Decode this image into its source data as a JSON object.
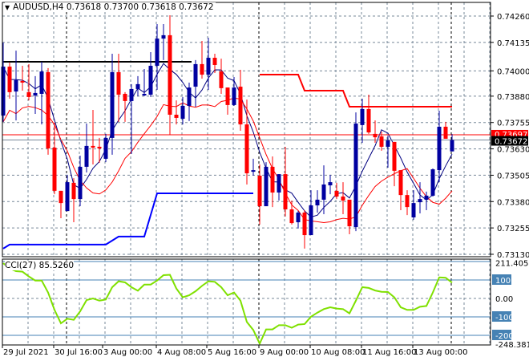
{
  "header": {
    "symbol": "AUDUSD,H4",
    "open": "0.73618",
    "high": "0.73700",
    "low": "0.73618",
    "close": "0.73672",
    "menu_icon": "triangle-down-icon"
  },
  "price_axis": {
    "ticks": [
      "0.74260",
      "0.74135",
      "0.74000",
      "0.73880",
      "0.73755",
      "0.73630",
      "0.73505",
      "0.73380",
      "0.73255",
      "0.73130"
    ],
    "ask_label": "0.73697",
    "bid_label": "0.73672"
  },
  "time_axis": {
    "labels": [
      "29 Jul 2021",
      "30 Jul 16:00",
      "3 Aug 00:00",
      "4 Aug 08:00",
      "5 Aug 16:00",
      "9 Aug 00:00",
      "10 Aug 08:00",
      "11 Aug 16:00",
      "13 Aug 00:00"
    ]
  },
  "indicator": {
    "label": "CCI(27) 85.5260",
    "axis_labels": [
      "211.4057",
      "100",
      "0.00",
      "-100",
      "-200",
      "-248.381"
    ],
    "levels": [
      200,
      100,
      -100,
      -200
    ],
    "max": 211.4057,
    "min": -248.381
  },
  "colors": {
    "bull": "#0000a0",
    "bear": "#ff0000",
    "ma": "#000080",
    "lower": "#ff0000",
    "cci": "#7fe000",
    "level": "#4682b4",
    "grid": "#778899",
    "resistance": "#ff0000",
    "support": "#0000ff"
  },
  "chart_data": {
    "type": "candlestick",
    "title": "AUDUSD,H4",
    "ylim": [
      0.7313,
      0.7426
    ],
    "ohlc": [
      [
        0.73788,
        0.74134,
        0.73758,
        0.7402
      ],
      [
        0.7402,
        0.74039,
        0.73868,
        0.73899
      ],
      [
        0.73902,
        0.74096,
        0.73765,
        0.73956
      ],
      [
        0.73952,
        0.74024,
        0.73906,
        0.73948
      ],
      [
        0.73899,
        0.74032,
        0.7386,
        0.73876
      ],
      [
        0.73883,
        0.73975,
        0.73796,
        0.73895
      ],
      [
        0.73891,
        0.74043,
        0.73746,
        0.73997
      ],
      [
        0.73994,
        0.74013,
        0.73602,
        0.73632
      ],
      [
        0.73636,
        0.73754,
        0.73415,
        0.73431
      ],
      [
        0.73431,
        0.73431,
        0.73301,
        0.73373
      ],
      [
        0.73335,
        0.73507,
        0.73335,
        0.73472
      ],
      [
        0.73469,
        0.73491,
        0.73282,
        0.73392
      ],
      [
        0.73392,
        0.73598,
        0.73358,
        0.73545
      ],
      [
        0.73545,
        0.7375,
        0.73518,
        0.73644
      ],
      [
        0.73644,
        0.73815,
        0.73556,
        0.73636
      ],
      [
        0.7364,
        0.73682,
        0.73564,
        0.73632
      ],
      [
        0.73583,
        0.73701,
        0.73567,
        0.73682
      ],
      [
        0.73682,
        0.74081,
        0.73602,
        0.73994
      ],
      [
        0.73994,
        0.74081,
        0.73758,
        0.73887
      ],
      [
        0.73891,
        0.73899,
        0.73758,
        0.73857
      ],
      [
        0.73857,
        0.73937,
        0.73606,
        0.73914
      ],
      [
        0.73914,
        0.73975,
        0.7388,
        0.73937
      ],
      [
        0.73887,
        0.74009,
        0.7388,
        0.73891
      ],
      [
        0.73887,
        0.74089,
        0.73876,
        0.74024
      ],
      [
        0.74024,
        0.74222,
        0.7391,
        0.74153
      ],
      [
        0.74153,
        0.74222,
        0.74051,
        0.74169
      ],
      [
        0.74169,
        0.74264,
        0.73697,
        0.73792
      ],
      [
        0.73792,
        0.7386,
        0.73746,
        0.73777
      ],
      [
        0.73773,
        0.73876,
        0.73746,
        0.73834
      ],
      [
        0.73834,
        0.73944,
        0.73762,
        0.73921
      ],
      [
        0.73925,
        0.74051,
        0.7383,
        0.74032
      ],
      [
        0.74032,
        0.74142,
        0.73963,
        0.73982
      ],
      [
        0.73982,
        0.74157,
        0.7391,
        0.74062
      ],
      [
        0.74062,
        0.74081,
        0.7399,
        0.74028
      ],
      [
        0.73997,
        0.74058,
        0.73891,
        0.73918
      ],
      [
        0.73921,
        0.73921,
        0.73792,
        0.73838
      ],
      [
        0.73838,
        0.73971,
        0.73834,
        0.73921
      ],
      [
        0.73925,
        0.74005,
        0.73716,
        0.73746
      ],
      [
        0.73746,
        0.73864,
        0.73461,
        0.73514
      ],
      [
        0.73522,
        0.73583,
        0.73503,
        0.73529
      ],
      [
        0.73503,
        0.73556,
        0.73271,
        0.73358
      ],
      [
        0.73358,
        0.73567,
        0.73358,
        0.73545
      ],
      [
        0.73545,
        0.73594,
        0.73354,
        0.73423
      ],
      [
        0.73423,
        0.7351,
        0.73385,
        0.7351
      ],
      [
        0.7351,
        0.7364,
        0.73309,
        0.73343
      ],
      [
        0.73343,
        0.73385,
        0.73271,
        0.73278
      ],
      [
        0.73282,
        0.73335,
        0.73252,
        0.73328
      ],
      [
        0.73328,
        0.73339,
        0.73157,
        0.73221
      ],
      [
        0.73221,
        0.73434,
        0.73221,
        0.73362
      ],
      [
        0.73362,
        0.73434,
        0.73328,
        0.73389
      ],
      [
        0.73389,
        0.73552,
        0.7332,
        0.73461
      ],
      [
        0.73457,
        0.73507,
        0.73415,
        0.73472
      ],
      [
        0.73431,
        0.73469,
        0.73392,
        0.73404
      ],
      [
        0.73404,
        0.73472,
        0.7332,
        0.73385
      ],
      [
        0.73389,
        0.73389,
        0.73225,
        0.73263
      ],
      [
        0.73259,
        0.73803,
        0.7324,
        0.7375
      ],
      [
        0.73743,
        0.73868,
        0.73659,
        0.73819
      ],
      [
        0.73819,
        0.73887,
        0.73701,
        0.73708
      ],
      [
        0.73701,
        0.73765,
        0.73659,
        0.73685
      ],
      [
        0.73689,
        0.73712,
        0.73621,
        0.7364
      ],
      [
        0.7364,
        0.73693,
        0.73541,
        0.7367
      ],
      [
        0.73663,
        0.73663,
        0.73453,
        0.73526
      ],
      [
        0.73529,
        0.73529,
        0.73339,
        0.73411
      ],
      [
        0.73411,
        0.73434,
        0.73316,
        0.73354
      ],
      [
        0.73305,
        0.73434,
        0.73294,
        0.73373
      ],
      [
        0.73377,
        0.73472,
        0.73324,
        0.73392
      ],
      [
        0.73389,
        0.73427,
        0.73339,
        0.73408
      ],
      [
        0.73408,
        0.73537,
        0.73404,
        0.73533
      ],
      [
        0.73529,
        0.73811,
        0.73472,
        0.73735
      ],
      [
        0.73735,
        0.73758,
        0.73678,
        0.73678
      ],
      [
        0.73618,
        0.737,
        0.73618,
        0.73672
      ]
    ],
    "cci": [
      191,
      162,
      148,
      145,
      119,
      97,
      97,
      32,
      -62,
      -135,
      -110,
      -116,
      -70,
      -9,
      0,
      -12,
      -6,
      61,
      93,
      87,
      61,
      42,
      75,
      75,
      97,
      126,
      128,
      54,
      6,
      17,
      39,
      68,
      93,
      90,
      61,
      17,
      32,
      -12,
      -128,
      -171,
      -245,
      -168,
      -168,
      -145,
      -145,
      -159,
      -142,
      -139,
      -99,
      -77,
      -58,
      -48,
      -55,
      -58,
      -81,
      -12,
      61,
      57,
      43,
      36,
      35,
      6,
      -48,
      -62,
      -62,
      -45,
      -41,
      32,
      114,
      112,
      85.526
    ],
    "resistance_line": [
      [
        40,
        0.73982
      ],
      [
        46,
        0.73982
      ],
      [
        47,
        0.73906
      ],
      [
        53,
        0.73906
      ],
      [
        54,
        0.7383
      ],
      [
        70,
        0.7383
      ]
    ],
    "support_line": [
      [
        0,
        0.73157
      ],
      [
        1,
        0.73176
      ],
      [
        16,
        0.73176
      ],
      [
        18,
        0.73214
      ],
      [
        22,
        0.73214
      ],
      [
        24,
        0.73419
      ],
      [
        39,
        0.73419
      ]
    ],
    "black_level": {
      "from": 0,
      "to": 29,
      "price": 0.74043
    },
    "ask_price": 0.73697,
    "bid_price": 0.73672
  }
}
